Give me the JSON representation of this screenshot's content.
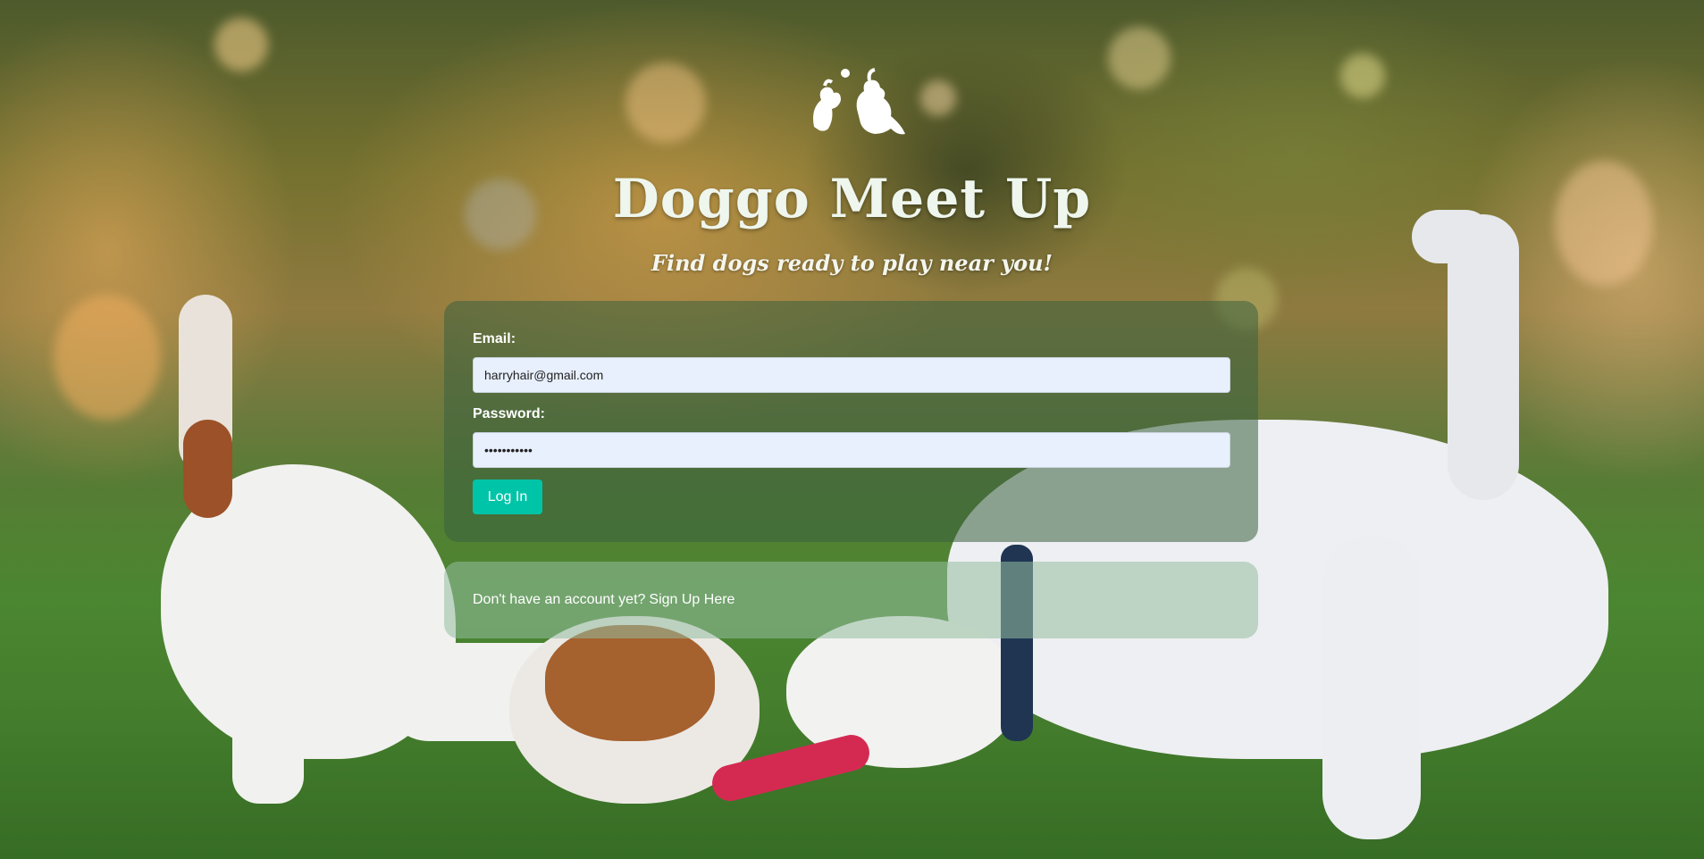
{
  "header": {
    "logo_icon": "dogs-playing-logo-icon",
    "title": "Doggo Meet Up",
    "subtitle": "Find dogs ready to play near you!"
  },
  "login_form": {
    "email_label": "Email:",
    "email_value": "harryhair@gmail.com",
    "password_label": "Password:",
    "password_value": "•••••••••••",
    "submit_label": "Log In"
  },
  "signup": {
    "prompt": "Don't have an account yet?",
    "link_label": "Sign Up Here"
  },
  "colors": {
    "button": "#00c4a7",
    "input_bg": "#e8f0fe",
    "title_text": "#eef6ee"
  }
}
